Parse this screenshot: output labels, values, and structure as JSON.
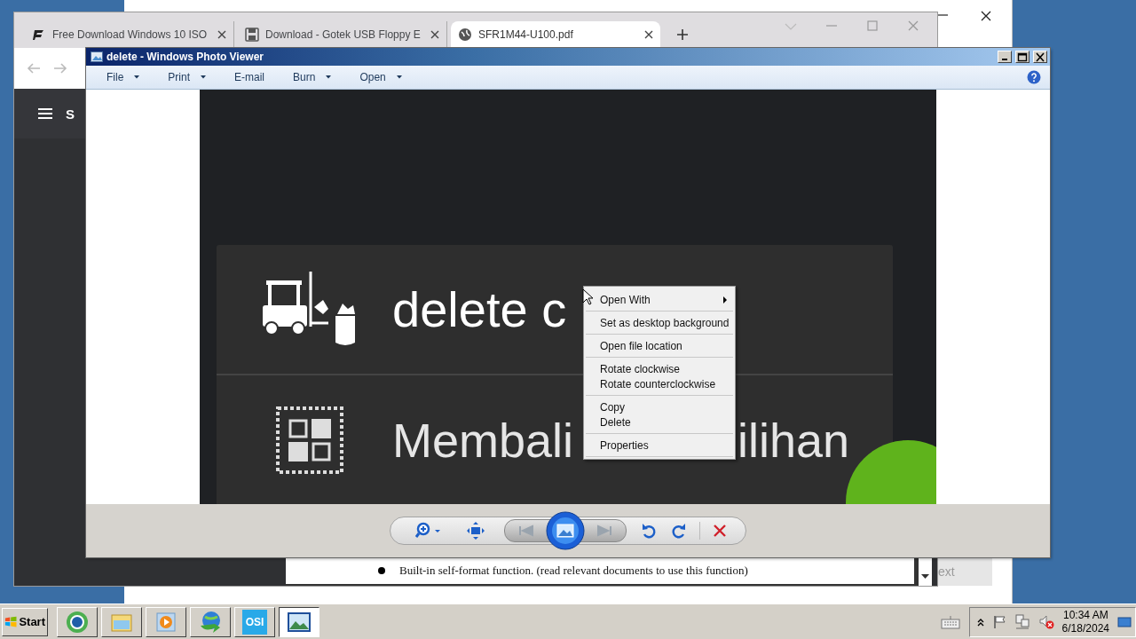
{
  "back_window": {
    "button_text": "ext"
  },
  "browser": {
    "tabs": [
      {
        "title": "Free Download Windows 10 ISO",
        "selected": false
      },
      {
        "title": "Download - Gotek USB Floppy E",
        "selected": false
      },
      {
        "title": "SFR1M44-U100.pdf",
        "selected": true
      }
    ],
    "page_header_text": "S",
    "pdf_bullet": "Built-in self-format function. (read relevant documents to use this function)"
  },
  "photo_viewer": {
    "title": "delete - Windows Photo Viewer",
    "menus": [
      {
        "label": "File",
        "dropdown": true
      },
      {
        "label": "Print",
        "dropdown": true
      },
      {
        "label": "E-mail",
        "dropdown": false
      },
      {
        "label": "Burn",
        "dropdown": true
      },
      {
        "label": "Open",
        "dropdown": true
      }
    ],
    "image_rows": [
      {
        "kind": "forklift",
        "texts": [
          "delete c"
        ]
      },
      {
        "kind": "select",
        "texts": [
          "Membali",
          "ilihan"
        ]
      }
    ]
  },
  "context_menu": {
    "groups": [
      {
        "items": [
          {
            "label": "Open With",
            "submenu": true
          }
        ]
      },
      {
        "items": [
          {
            "label": "Set as desktop background",
            "submenu": false
          }
        ]
      },
      {
        "items": [
          {
            "label": "Open file location",
            "submenu": false
          }
        ]
      },
      {
        "items": [
          {
            "label": "Rotate clockwise",
            "submenu": false
          },
          {
            "label": "Rotate counterclockwise",
            "submenu": false
          }
        ]
      },
      {
        "items": [
          {
            "label": "Copy",
            "submenu": false
          },
          {
            "label": "Delete",
            "submenu": false
          }
        ]
      },
      {
        "items": [
          {
            "label": "Properties",
            "submenu": false
          }
        ]
      }
    ]
  },
  "taskbar": {
    "start": "Start",
    "apps": [
      {
        "kind": "browser",
        "selected": false
      },
      {
        "kind": "folder",
        "selected": false
      },
      {
        "kind": "media",
        "selected": false
      },
      {
        "kind": "download",
        "selected": false
      },
      {
        "kind": "app",
        "label": "OSI",
        "selected": false
      },
      {
        "kind": "photos",
        "selected": true
      }
    ],
    "clock": {
      "time": "10:34 AM",
      "date": "6/18/2024"
    }
  }
}
